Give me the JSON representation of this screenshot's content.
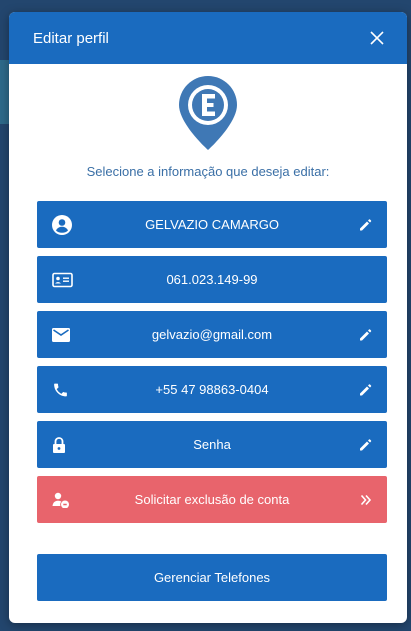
{
  "modal": {
    "title": "Editar perfil",
    "instruction": "Selecione a informação que deseja editar:"
  },
  "options": [
    {
      "label": "GELVAZIO CAMARGO",
      "icon": "account-circle-icon",
      "editable": true
    },
    {
      "label": "061.023.149-99",
      "icon": "id-card-icon",
      "editable": false
    },
    {
      "label": "gelvazio@gmail.com",
      "icon": "mail-icon",
      "editable": true
    },
    {
      "label": "+55 47 98863-0404",
      "icon": "phone-icon",
      "editable": true
    },
    {
      "label": "Senha",
      "icon": "lock-icon",
      "editable": true
    }
  ],
  "delete_account": {
    "label": "Solicitar exclusão de conta",
    "icon": "user-remove-icon",
    "action_icon": "double-chevron-right-icon"
  },
  "manage_phones": {
    "label": "Gerenciar Telefones"
  },
  "colors": {
    "primary": "#1a6bbf",
    "danger": "#e8646c",
    "backdrop": "#23466e",
    "instruction_text": "#3a6fa6"
  }
}
